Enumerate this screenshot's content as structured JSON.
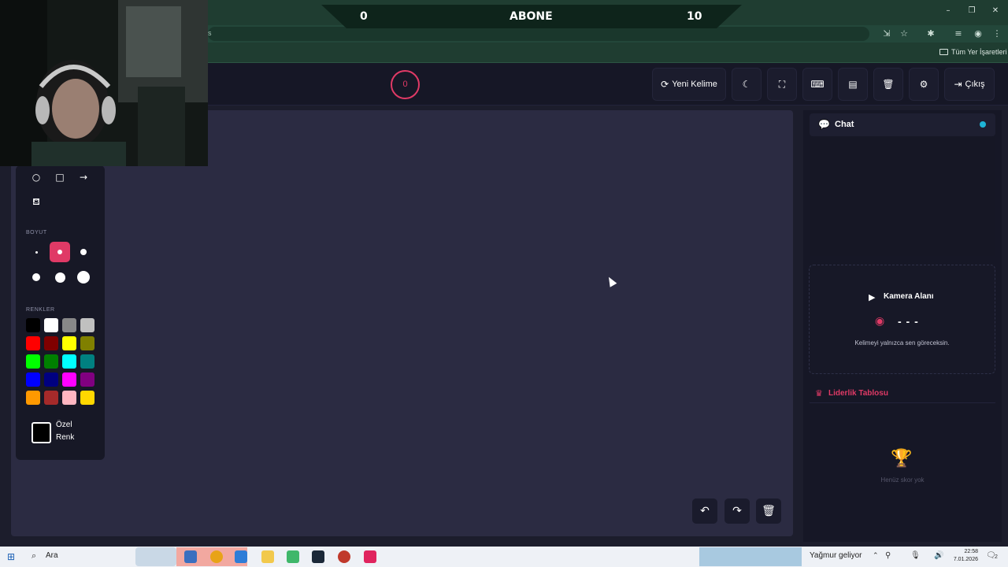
{
  "banner": {
    "left_value": "0",
    "center_label": "ABONE",
    "right_value": "10"
  },
  "browser": {
    "address_fragment": "s",
    "bookmarks_label": "Tüm Yer İşaretleri"
  },
  "header": {
    "timer": "0",
    "new_word_label": "Yeni Kelime",
    "exit_label": "Çıkış"
  },
  "tools": {
    "size_label": "BOYUT",
    "colors_label": "RENKLER",
    "custom_color_label": "Özel Renk",
    "selected_size_index": 1,
    "colors": [
      "#000000",
      "#ffffff",
      "#888888",
      "#c0c0c0",
      "#ff0000",
      "#800000",
      "#ffff00",
      "#808000",
      "#00ff00",
      "#008000",
      "#00ffff",
      "#008080",
      "#0000ff",
      "#000080",
      "#ff00ff",
      "#800080",
      "#ff9900",
      "#a52a2a",
      "#ffb6c1",
      "#ffd700"
    ]
  },
  "chat": {
    "title": "Chat",
    "status_color": "#1eb4d6"
  },
  "camera": {
    "title": "Kamera Alanı",
    "word_mask": "- - -",
    "hint": "Kelimeyi yalnızca sen göreceksin."
  },
  "leaderboard": {
    "title": "Liderlik Tablosu",
    "empty_text": "Henüz skor yok"
  },
  "taskbar": {
    "search_label": "Ara",
    "weather": "Yağmur geliyor",
    "time": "22:58",
    "date": "7.01.2026",
    "notif_count": "2"
  },
  "accent_color": "#e03a66"
}
